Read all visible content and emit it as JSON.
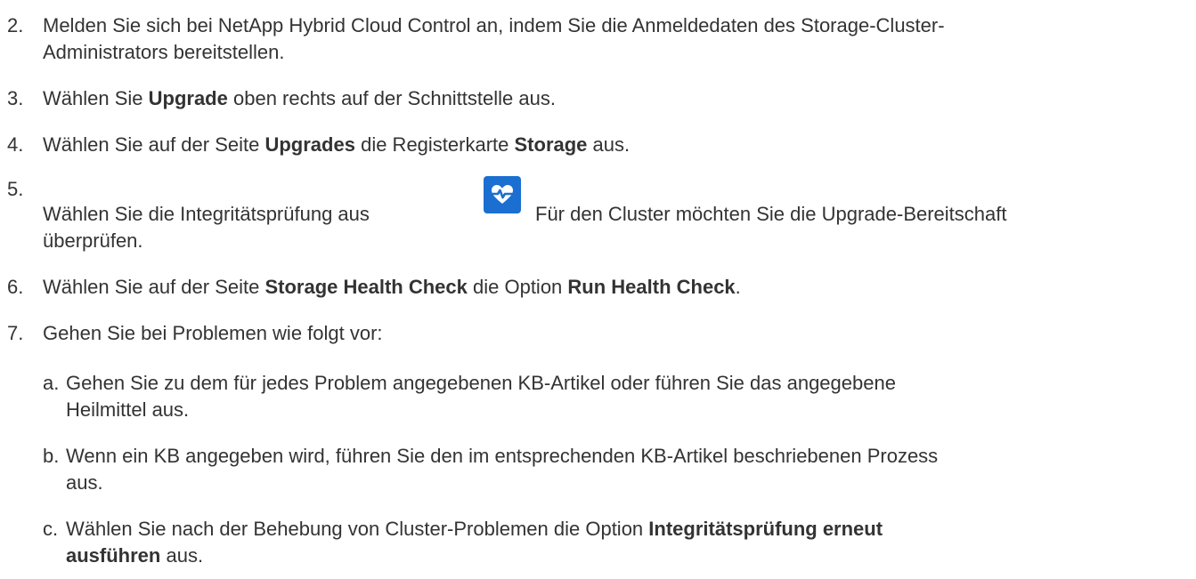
{
  "steps": [
    {
      "num": "2.",
      "line1": "Melden Sie sich bei NetApp Hybrid Cloud Control an, indem Sie die Anmeldedaten des Storage-Cluster-",
      "line2": "Administrators bereitstellen."
    },
    {
      "num": "3.",
      "pre": "Wählen Sie ",
      "bold": "Upgrade",
      "post": " oben rechts auf der Schnittstelle aus."
    },
    {
      "num": "4.",
      "pre": "Wählen Sie auf der Seite ",
      "bold1": "Upgrades",
      "mid": " die Registerkarte ",
      "bold2": "Storage",
      "post": " aus."
    },
    {
      "num": "5.",
      "pre": "Wählen Sie die Integritätsprüfung aus",
      "post": "Für den Cluster möchten Sie die Upgrade-Bereitschaft",
      "line2": "überprüfen.",
      "icon": "heart-pulse-icon"
    },
    {
      "num": "6.",
      "pre": "Wählen Sie auf der Seite ",
      "bold1": "Storage Health Check",
      "mid": " die Option ",
      "bold2": "Run Health Check",
      "post": "."
    },
    {
      "num": "7.",
      "text": "Gehen Sie bei Problemen wie folgt vor:"
    }
  ],
  "substeps": [
    {
      "num": "a.",
      "line1": "Gehen Sie zu dem für jedes Problem angegebenen KB-Artikel oder führen Sie das angegebene",
      "line2": "Heilmittel aus."
    },
    {
      "num": "b.",
      "line1": "Wenn ein KB angegeben wird, führen Sie den im entsprechenden KB-Artikel beschriebenen Prozess",
      "line2": "aus."
    },
    {
      "num": "c.",
      "pre": "Wählen Sie nach der Behebung von Cluster-Problemen die Option ",
      "bold_a": "Integritätsprüfung erneut",
      "bold_b": "ausführen",
      "post": " aus."
    }
  ],
  "colors": {
    "text": "#333333",
    "icon_bg": "#1a6fd1",
    "icon_fg": "#ffffff"
  }
}
